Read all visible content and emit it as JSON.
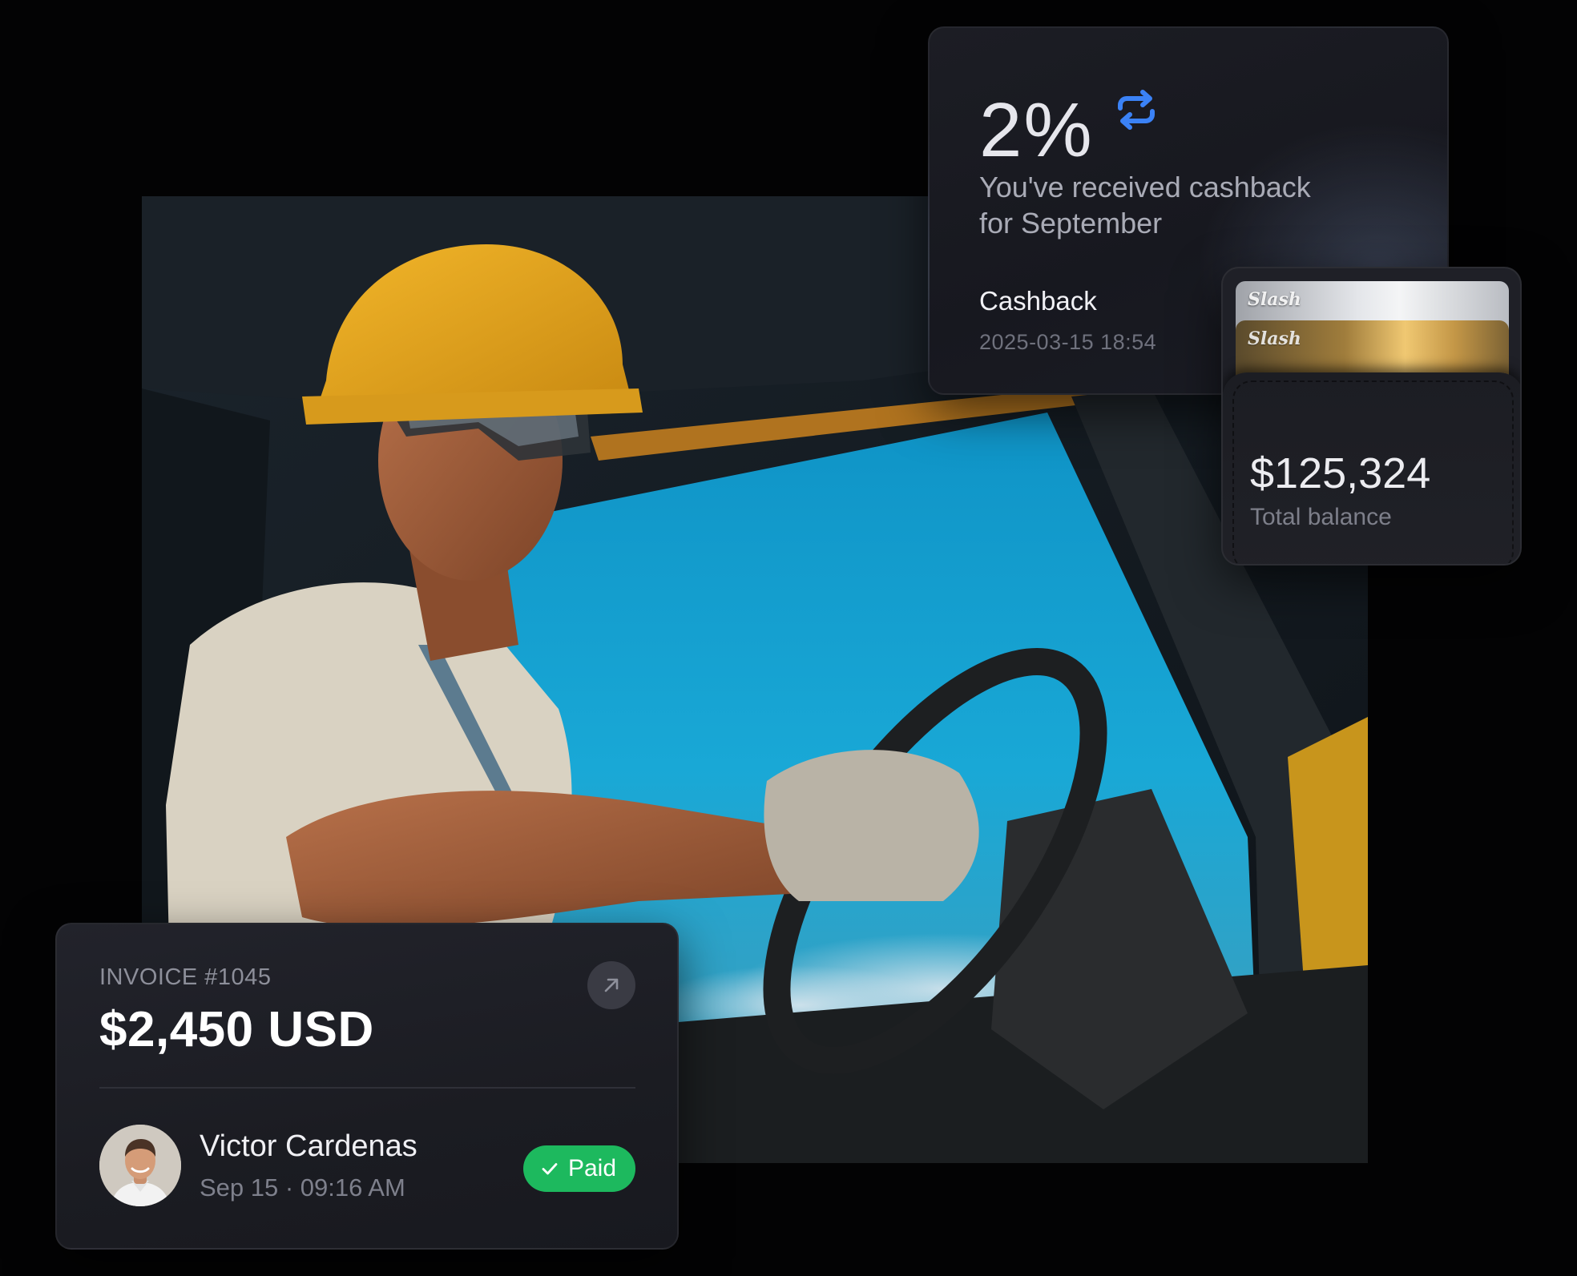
{
  "cashback": {
    "percent": "2%",
    "icon": "repeat-icon",
    "description": "You've received cashback for September",
    "title": "Cashback",
    "timestamp": "2025-03-15 18:54"
  },
  "wallet": {
    "cards": [
      {
        "label": "Slash",
        "finish": "silver"
      },
      {
        "label": "Slash",
        "finish": "gold"
      }
    ],
    "balance": "$125,324",
    "balance_label": "Total balance"
  },
  "invoice": {
    "number": "INVOICE #1045",
    "amount": "$2,450 USD",
    "open_icon": "arrow-up-right-icon",
    "customer_name": "Victor Cardenas",
    "date": "Sep 15 · 09:16 AM",
    "status": "Paid",
    "status_icon": "check-icon"
  },
  "colors": {
    "background": "#030304",
    "card": "#1c1d24",
    "accent_blue": "#3b82f6",
    "paid_green": "#1db95e"
  }
}
